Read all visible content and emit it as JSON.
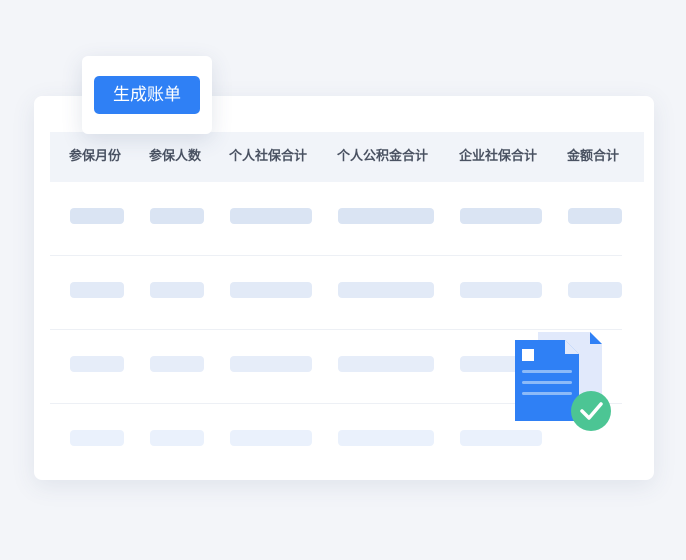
{
  "toolbar": {
    "generate_bill_label": "生成账单"
  },
  "table": {
    "columns": [
      "参保月份",
      "参保人数",
      "个人社保合计",
      "个人公积金合计",
      "企业社保合计",
      "金额合计"
    ],
    "placeholder_rows": 4
  },
  "colors": {
    "accent": "#2f80f5",
    "header_bg": "#f1f4f9",
    "skeleton": "#dae4f3",
    "skeleton_faint": "#eaf1fc",
    "success": "#4cc594",
    "doc_back": "#e1e9fb"
  },
  "icons": [
    "document-icon",
    "check-circle-icon"
  ]
}
